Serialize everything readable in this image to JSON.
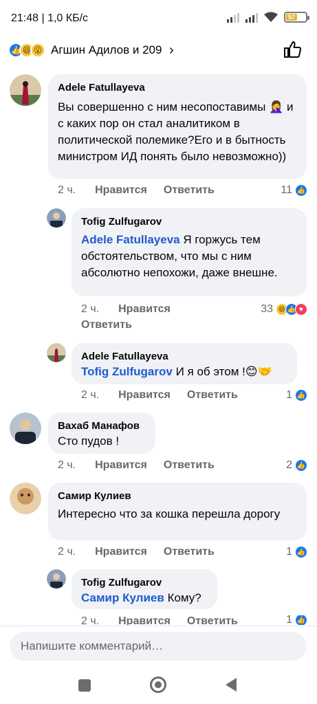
{
  "status": {
    "text": "21:48 | 1,0 КБ/с",
    "battery": "57"
  },
  "header": {
    "reactors": "Агшин Адилов и 209",
    "chevron": "›",
    "icons": [
      "like-reaction-icon",
      "haha-reaction-icon",
      "wow-reaction-icon",
      "thumbs-up-icon"
    ]
  },
  "comments": [
    {
      "author": "Adele Fatullayeva",
      "text": "Вы совершенно с ним несопоставимы 🤦‍♀️ и с каких пор он стал аналитиком в политической полемике?Его и в бытность министром ИД понять было невозможно))",
      "time": "2 ч.",
      "like": "Нравится",
      "reply": "Ответить",
      "count": "11"
    },
    {
      "author": "Tofig Zulfugarov",
      "mention": "Adele Fatullayeva",
      "text": " Я горжусь тем обстоятельством, что мы с ним абсолютно непохожи, даже внешне.",
      "time": "2 ч.",
      "like": "Нравится",
      "reply": "Ответить",
      "count": "33"
    },
    {
      "author": "Adele Fatullayeva",
      "mention": "Tofig Zulfugarov",
      "text": " И я об этом !😊🤝",
      "time": "2 ч.",
      "like": "Нравится",
      "reply": "Ответить",
      "count": "1"
    },
    {
      "author": "Вахаб Манафов",
      "text": "Сто пудов !",
      "time": "2 ч.",
      "like": "Нравится",
      "reply": "Ответить",
      "count": "2"
    },
    {
      "author": "Самир Кулиев",
      "text": "Интересно что за кошка перешла дорогу",
      "time": "2 ч.",
      "like": "Нравится",
      "reply": "Ответить",
      "count": "1"
    },
    {
      "author": "Tofig Zulfugarov",
      "mention": "Самир Кулиев",
      "text": " Кому?",
      "time": "2 ч.",
      "like": "Нравится",
      "reply": "Ответить",
      "count": "1"
    }
  ],
  "input": {
    "placeholder": "Напишите комментарий…"
  },
  "colors": {
    "bubble": "#f0f2f5",
    "mention": "#1d5bd1",
    "like_blue": "#1877f2",
    "meta_gray": "#65676b"
  }
}
